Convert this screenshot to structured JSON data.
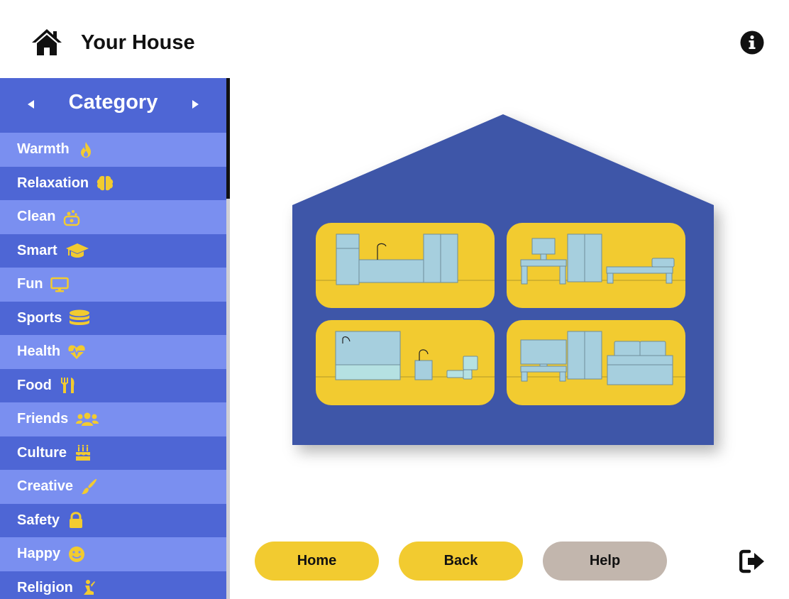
{
  "header": {
    "title": "Your House",
    "home_icon": "home-icon",
    "info_icon": "info-circle-icon"
  },
  "sidebar": {
    "heading": "Category",
    "prev_icon": "triangle-left-icon",
    "next_icon": "triangle-right-icon",
    "items": [
      {
        "label": "Warmth",
        "icon": "flame-icon"
      },
      {
        "label": "Relaxation",
        "icon": "brain-icon"
      },
      {
        "label": "Clean",
        "icon": "soap-icon"
      },
      {
        "label": "Smart",
        "icon": "graduation-cap-icon"
      },
      {
        "label": "Fun",
        "icon": "monitor-icon"
      },
      {
        "label": "Sports",
        "icon": "database-icon"
      },
      {
        "label": "Health",
        "icon": "heartbeat-icon"
      },
      {
        "label": "Food",
        "icon": "utensils-icon"
      },
      {
        "label": "Friends",
        "icon": "users-icon"
      },
      {
        "label": "Culture",
        "icon": "birthday-cake-icon"
      },
      {
        "label": "Creative",
        "icon": "paint-brush-icon"
      },
      {
        "label": "Safety",
        "icon": "lock-icon"
      },
      {
        "label": "Happy",
        "icon": "smile-icon"
      },
      {
        "label": "Religion",
        "icon": "praying-icon"
      }
    ]
  },
  "house": {
    "rooms": [
      "kitchen-room",
      "office-room",
      "bedroom-room",
      "living-room"
    ]
  },
  "footer": {
    "home_label": "Home",
    "back_label": "Back",
    "help_label": "Help",
    "logout_icon": "sign-out-icon"
  },
  "colors": {
    "primary_blue": "#4e66d5",
    "light_blue": "#7a8ff0",
    "house_blue": "#3e56a8",
    "accent_yellow": "#f2cb30",
    "help_gray": "#c2b6ad",
    "furniture_blue": "#a6cfde"
  }
}
